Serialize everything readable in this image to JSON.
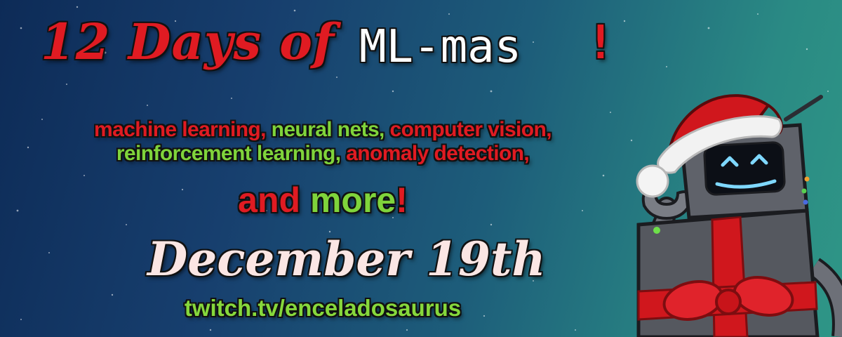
{
  "title": {
    "script_part": "12 Days of",
    "mono_part": "ML-mas",
    "exclaim": "!"
  },
  "topics": {
    "line1": [
      {
        "text": "machine learning, ",
        "color": "red"
      },
      {
        "text": "neural nets, ",
        "color": "green"
      },
      {
        "text": "computer vision,",
        "color": "red"
      }
    ],
    "line2": [
      {
        "text": "reinforcement learning, ",
        "color": "green"
      },
      {
        "text": "anomaly detection,",
        "color": "red"
      }
    ]
  },
  "more": {
    "and": "and ",
    "more": "more",
    "bang": "!"
  },
  "date": "December 19th",
  "url": "twitch.tv/enceladosaurus",
  "colors": {
    "red": "#e01b22",
    "green": "#7fd43b",
    "white": "#ffffff",
    "date": "#fbe6e4"
  },
  "illustration": "robot-with-santa-hat-icon"
}
